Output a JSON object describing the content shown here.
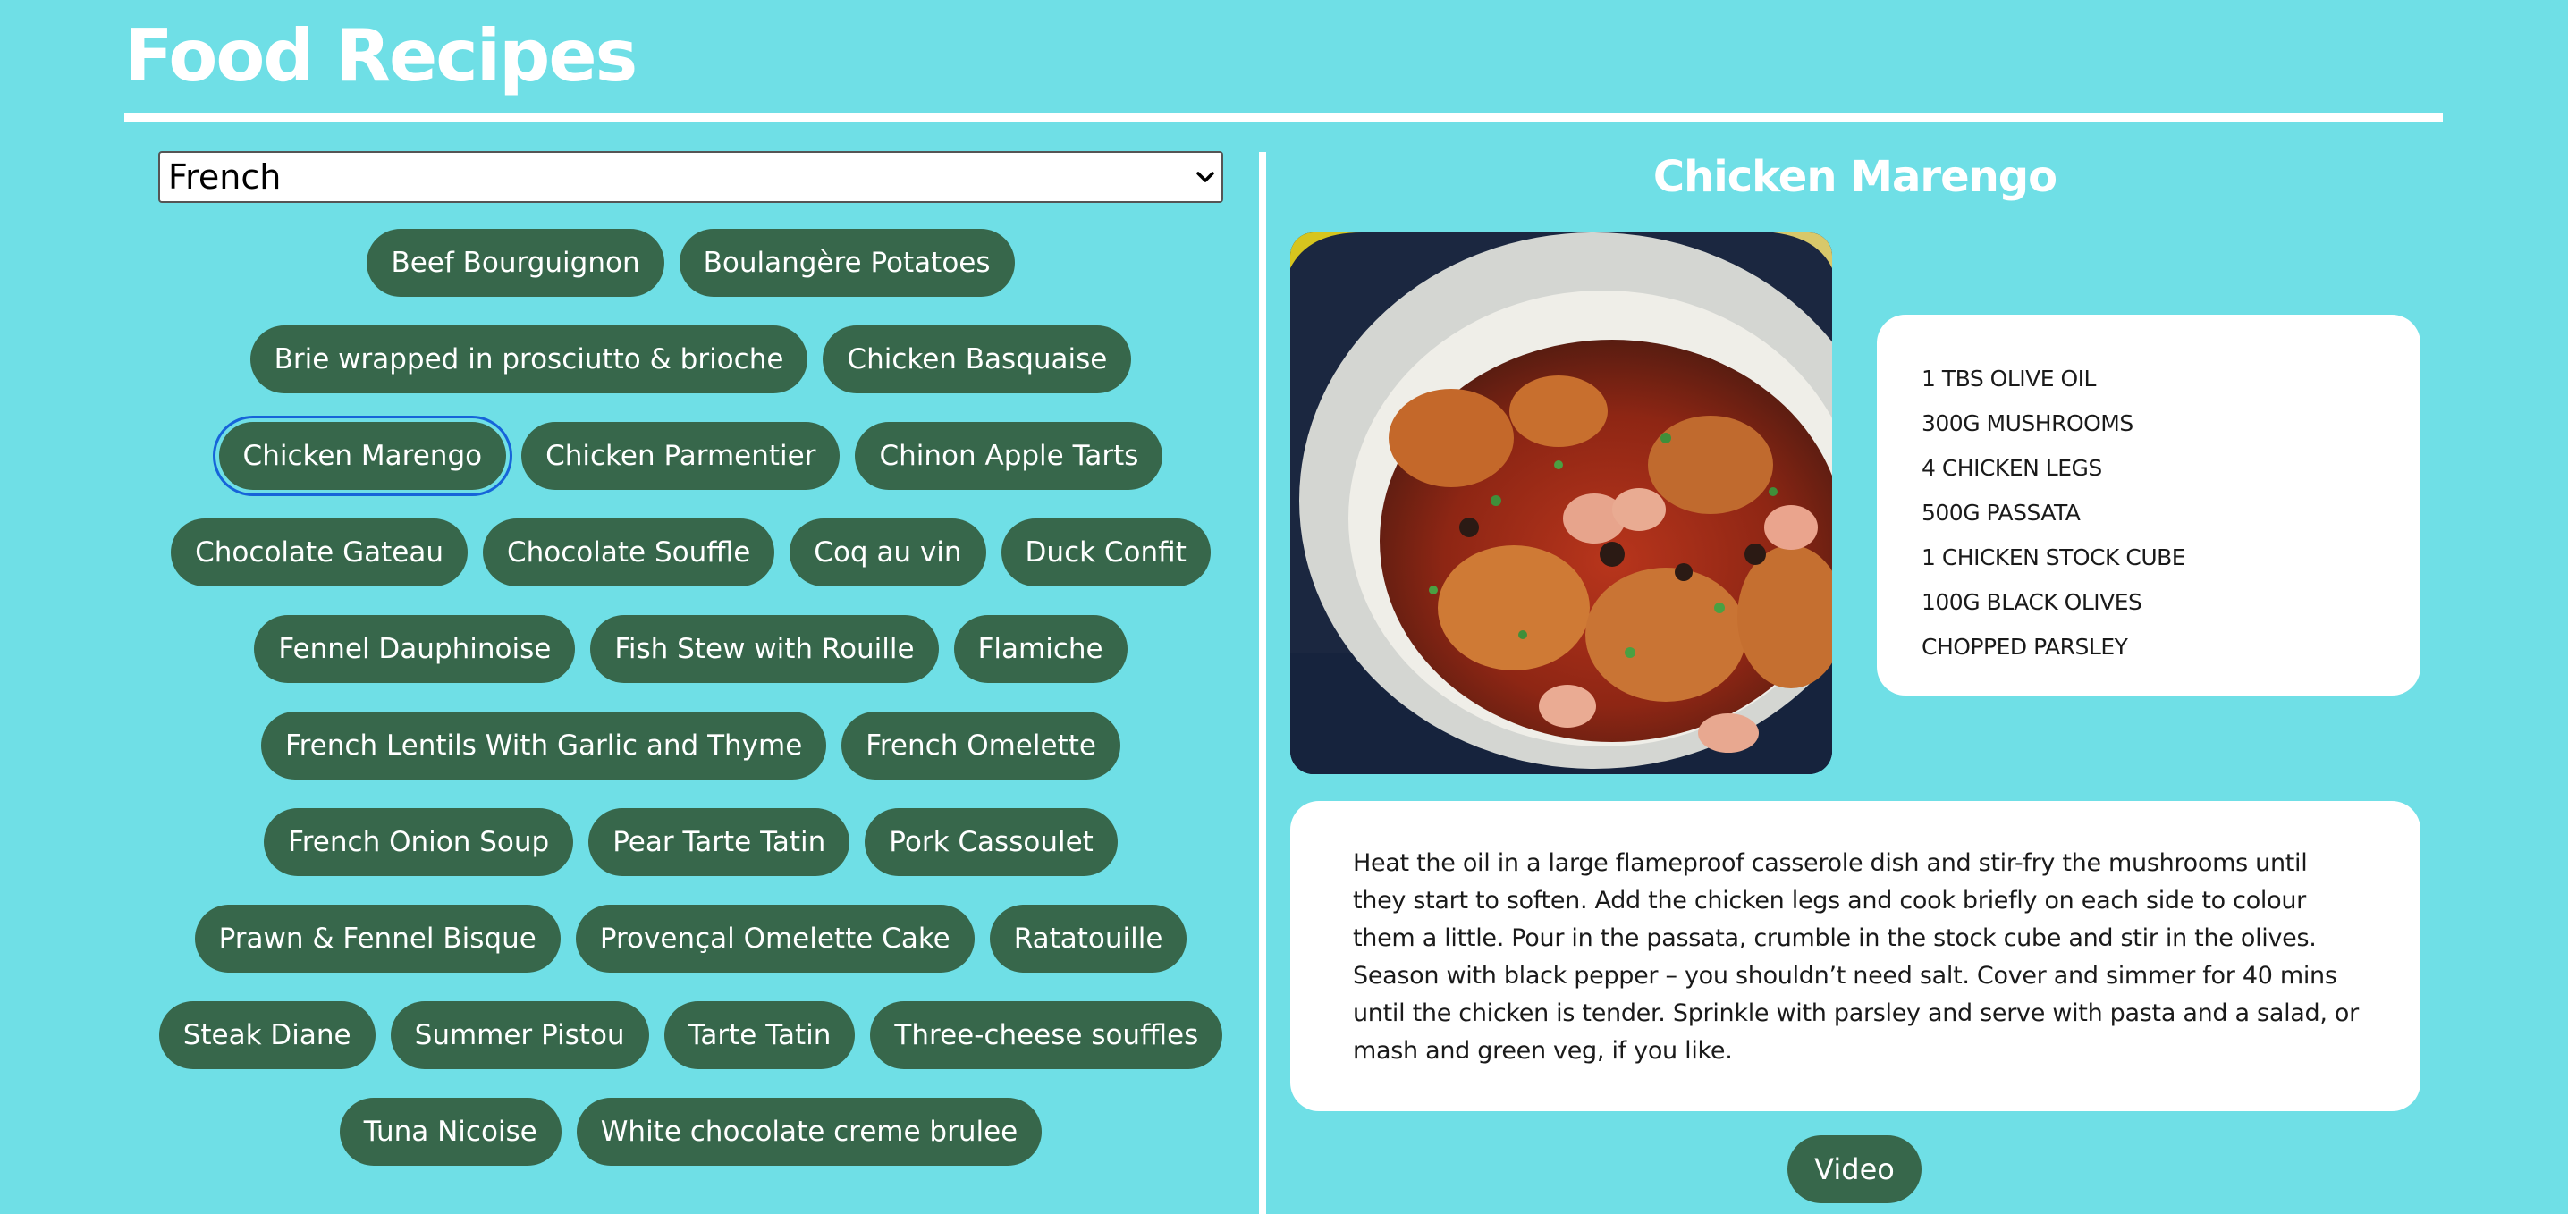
{
  "header": {
    "title": "Food Recipes"
  },
  "cuisine_select": {
    "selected": "French",
    "icon": "chevron-down-icon"
  },
  "recipes": [
    "Beef Bourguignon",
    "Boulangère Potatoes",
    "Brie wrapped in prosciutto & brioche",
    "Chicken Basquaise",
    "Chicken Marengo",
    "Chicken Parmentier",
    "Chinon Apple Tarts",
    "Chocolate Gateau",
    "Chocolate Souffle",
    "Coq au vin",
    "Duck Confit",
    "Fennel Dauphinoise",
    "Fish Stew with Rouille",
    "Flamiche",
    "French Lentils With Garlic and Thyme",
    "French Omelette",
    "French Onion Soup",
    "Pear Tarte Tatin",
    "Pork Cassoulet",
    "Prawn & Fennel Bisque",
    "Provençal Omelette Cake",
    "Ratatouille",
    "Steak Diane",
    "Summer Pistou",
    "Tarte Tatin",
    "Three-cheese souffles",
    "Tuna Nicoise",
    "White chocolate creme brulee"
  ],
  "selected_recipe": "Chicken Marengo",
  "detail": {
    "title": "Chicken Marengo",
    "ingredients": [
      "1 TBS OLIVE OIL",
      "300G MUSHROOMS",
      "4 CHICKEN LEGS",
      "500G PASSATA",
      "1 CHICKEN STOCK CUBE",
      "100G BLACK OLIVES",
      "CHOPPED PARSLEY"
    ],
    "method": "Heat the oil in a large flameproof casserole dish and stir-fry the mushrooms until they start to soften. Add the chicken legs and cook briefly on each side to colour them a little. Pour in the passata, crumble in the stock cube and stir in the olives. Season with black pepper – you shouldn’t need salt. Cover and simmer for 40 mins until the chicken is tender. Sprinkle with parsley and serve with pasta and a salad, or mash and green veg, if you like.",
    "video_label": "Video"
  },
  "colors": {
    "background": "#6fdfe6",
    "pill": "#37674b",
    "card": "#ffffff",
    "focus_ring": "#1664d9"
  }
}
